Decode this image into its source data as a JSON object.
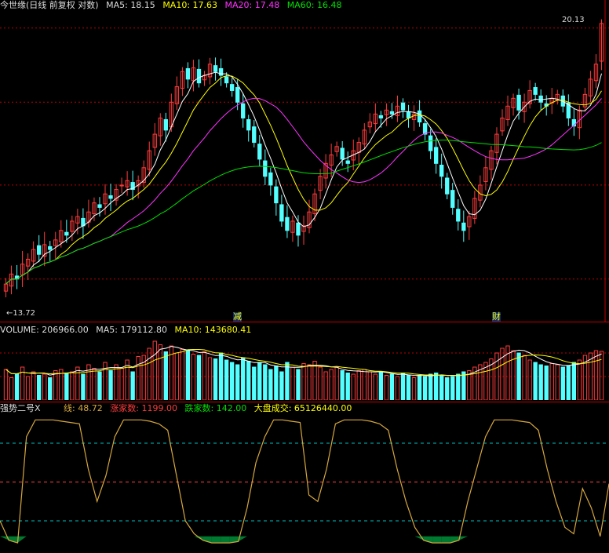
{
  "price_panel": {
    "title": "今世缘(日线 前复权 对数)",
    "ma5_label": "MA5:",
    "ma5_value": "18.15",
    "ma10_label": "MA10:",
    "ma10_value": "17.63",
    "ma20_label": "MA20:",
    "ma20_value": "17.48",
    "ma60_label": "MA60:",
    "ma60_value": "16.48",
    "high_label": "20.13",
    "low_label": "←13.72",
    "marker_1": "减",
    "marker_2": "财"
  },
  "volume_panel": {
    "volume_label": "VOLUME:",
    "volume_value": "206966.00",
    "ma5_label": "MA5:",
    "ma5_value": "179112.80",
    "ma10_label": "MA10:",
    "ma10_value": "143680.41"
  },
  "indicator_panel": {
    "name": "强势二号X",
    "line_label": "线:",
    "line_value": "48.72",
    "up_label": "涨家数:",
    "up_value": "1199.00",
    "down_label": "跌家数:",
    "down_value": "142.00",
    "market_label": "大盘成交:",
    "market_value": "65126440.00"
  },
  "colors": {
    "up": "#ff3c3c",
    "down": "#54ffff",
    "ma5": "#ffffff",
    "ma10": "#ffff00",
    "ma20": "#ff33ff",
    "ma60": "#00e000",
    "indicator": "#d7a83c",
    "fill": "#007a30",
    "grid": "#c00000"
  },
  "chart_data": {
    "type": "candlestick",
    "ylim": [
      13.4,
      20.4
    ],
    "high": 20.13,
    "low": 13.72,
    "closes": [
      13.9,
      14.1,
      14.0,
      14.3,
      14.4,
      14.6,
      14.5,
      14.7,
      14.6,
      14.8,
      15.0,
      14.9,
      15.2,
      15.3,
      15.1,
      15.4,
      15.6,
      15.5,
      15.8,
      15.7,
      15.9,
      16.0,
      16.1,
      15.9,
      16.1,
      16.4,
      16.8,
      17.2,
      17.6,
      17.3,
      18.0,
      18.4,
      18.8,
      18.6,
      18.9,
      18.5,
      18.7,
      19.0,
      18.8,
      18.7,
      18.5,
      18.3,
      18.0,
      17.6,
      17.3,
      17.0,
      16.6,
      16.2,
      16.0,
      15.6,
      15.2,
      15.0,
      15.2,
      14.9,
      15.1,
      15.4,
      15.8,
      16.2,
      16.5,
      16.7,
      16.9,
      16.6,
      16.5,
      16.8,
      17.0,
      17.3,
      17.5,
      17.7,
      17.6,
      17.8,
      17.7,
      17.9,
      17.8,
      17.6,
      17.7,
      17.5,
      17.2,
      16.8,
      16.5,
      16.2,
      15.8,
      15.5,
      15.2,
      15.0,
      15.3,
      15.7,
      16.0,
      16.4,
      16.8,
      17.2,
      17.6,
      17.9,
      18.1,
      17.8,
      18.0,
      18.3,
      18.2,
      18.0,
      17.9,
      18.1,
      18.2,
      17.9,
      17.6,
      17.4,
      17.8,
      18.2,
      18.6,
      19.0,
      20.13
    ],
    "volume": [
      130,
      95,
      110,
      140,
      100,
      120,
      105,
      110,
      95,
      125,
      130,
      115,
      120,
      140,
      110,
      150,
      135,
      120,
      160,
      125,
      150,
      135,
      170,
      120,
      185,
      190,
      220,
      250,
      235,
      205,
      230,
      200,
      215,
      210,
      195,
      190,
      205,
      180,
      175,
      200,
      170,
      160,
      150,
      180,
      165,
      140,
      160,
      150,
      130,
      145,
      120,
      160,
      140,
      130,
      155,
      150,
      165,
      140,
      120,
      130,
      140,
      125,
      115,
      110,
      125,
      130,
      120,
      110,
      120,
      105,
      110,
      100,
      115,
      105,
      95,
      105,
      100,
      110,
      115,
      105,
      95,
      100,
      110,
      120,
      125,
      140,
      150,
      160,
      175,
      200,
      220,
      230,
      210,
      200,
      190,
      170,
      160,
      150,
      145,
      155,
      150,
      140,
      145,
      160,
      170,
      190,
      200,
      210,
      206.97
    ],
    "indicator": [
      20,
      5,
      3,
      85,
      98,
      98,
      98,
      97,
      96,
      95,
      60,
      35,
      55,
      85,
      98,
      98,
      98,
      97,
      95,
      90,
      55,
      20,
      10,
      5,
      3,
      3,
      3,
      4,
      30,
      65,
      85,
      98,
      98,
      97,
      96,
      40,
      35,
      60,
      95,
      98,
      98,
      98,
      97,
      95,
      90,
      60,
      35,
      15,
      5,
      3,
      3,
      3,
      5,
      35,
      60,
      85,
      98,
      98,
      98,
      97,
      96,
      90,
      60,
      35,
      15,
      10,
      45,
      30,
      8,
      48.72
    ]
  }
}
